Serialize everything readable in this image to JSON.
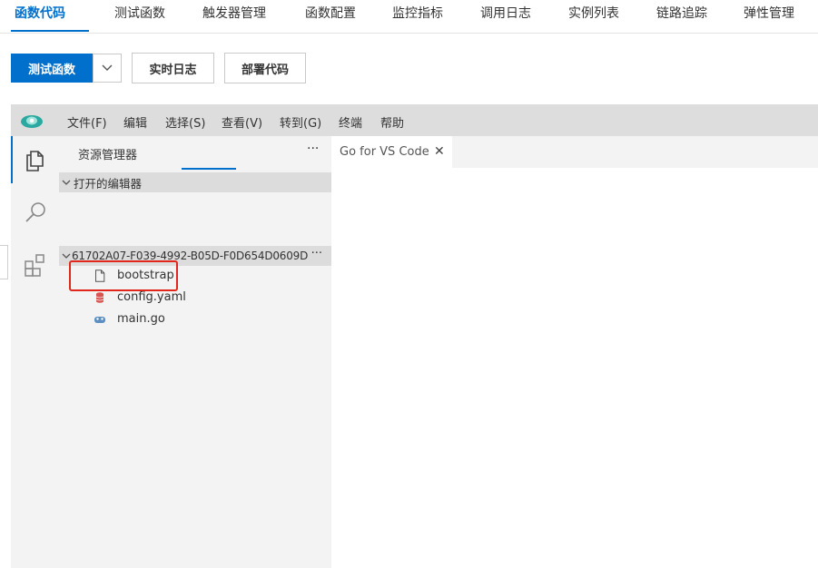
{
  "tabs": [
    "函数代码",
    "测试函数",
    "触发器管理",
    "函数配置",
    "监控指标",
    "调用日志",
    "实例列表",
    "链路追踪",
    "弹性管理"
  ],
  "actions": {
    "test_label": "测试函数",
    "realtime_log_label": "实时日志",
    "deploy_label": "部署代码"
  },
  "menubar": [
    "文件(F)",
    "编辑",
    "选择(S)",
    "查看(V)",
    "转到(G)",
    "终端",
    "帮助"
  ],
  "activity_icons": [
    "files-icon",
    "search-icon",
    "extensions-icon"
  ],
  "explorer": {
    "title": "资源管理器",
    "more": "···",
    "open_editors_label": "打开的编辑器",
    "folder_label": "61702A07-F039-4992-B05D-F0D654D0609D",
    "folder_more": "···",
    "files": [
      {
        "name": "bootstrap",
        "icon": "file-icon"
      },
      {
        "name": "config.yaml",
        "icon": "database-icon"
      },
      {
        "name": "main.go",
        "icon": "go-file-icon"
      }
    ]
  },
  "editor": {
    "tab_label": "Go for VS Code",
    "close": "✕"
  },
  "colors": {
    "accent": "#0070cc",
    "highlight": "#e0261d"
  }
}
